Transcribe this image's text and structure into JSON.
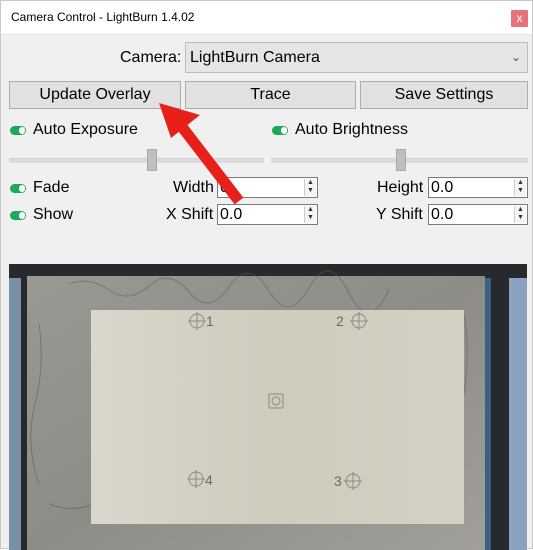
{
  "window": {
    "title": "Camera Control - LightBurn 1.4.02",
    "close_glyph": "x"
  },
  "camera": {
    "label": "Camera:",
    "selected": "LightBurn Camera"
  },
  "buttons": {
    "update_overlay": "Update Overlay",
    "trace": "Trace",
    "save_settings": "Save Settings"
  },
  "toggles": {
    "auto_exposure": "Auto Exposure",
    "auto_brightness": "Auto Brightness",
    "fade": "Fade",
    "show": "Show"
  },
  "fields": {
    "width": {
      "label": "Width",
      "value": "0"
    },
    "height": {
      "label": "Height",
      "value": "0.0"
    },
    "x_shift": {
      "label": "X Shift",
      "value": "0.0"
    },
    "y_shift": {
      "label": "Y Shift",
      "value": "0.0"
    }
  },
  "preview": {
    "corner_labels": [
      "1",
      "2",
      "4",
      "3"
    ]
  },
  "colors": {
    "toggle_on": "#1aa85a",
    "arrow": "#e8201a",
    "close": "#e5737a"
  }
}
